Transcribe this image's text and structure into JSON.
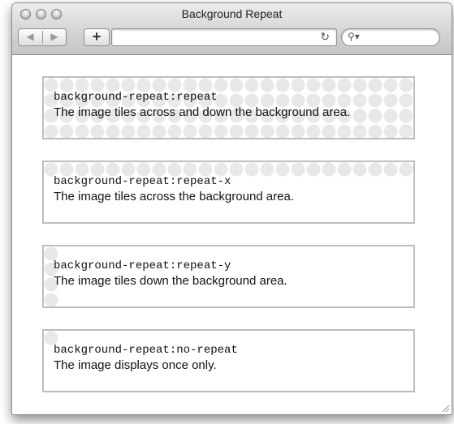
{
  "window": {
    "title": "Background Repeat"
  },
  "toolbar": {
    "back_icon": "back-arrow-icon",
    "forward_icon": "forward-arrow-icon",
    "add_icon": "plus-icon",
    "reload_icon": "reload-icon",
    "search_icon": "search-icon",
    "url": ""
  },
  "boxes": [
    {
      "code": "background-repeat:repeat",
      "description": "The image tiles across and down the background area.",
      "mode": "repeat"
    },
    {
      "code": "background-repeat:repeat-x",
      "description": "The image tiles across the background area.",
      "mode": "repeat-x"
    },
    {
      "code": "background-repeat:repeat-y",
      "description": "The image tiles down the background area.",
      "mode": "repeat-y"
    },
    {
      "code": "background-repeat:no-repeat",
      "description": "The image displays once only.",
      "mode": "no-repeat"
    }
  ],
  "colors": {
    "circle": "#e8e8e8",
    "border": "#bdbdbd"
  }
}
